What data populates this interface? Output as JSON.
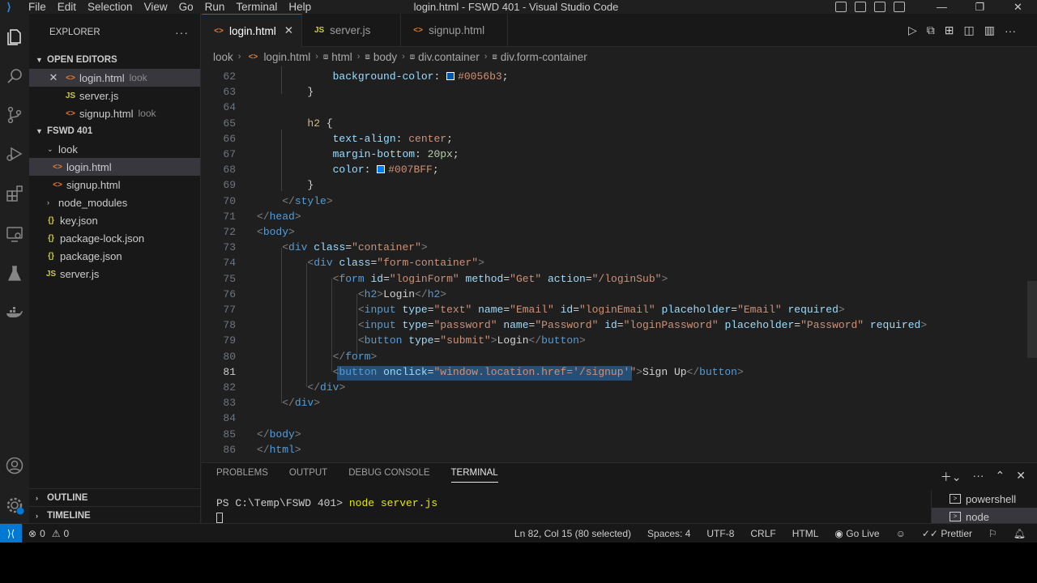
{
  "window": {
    "title": "login.html - FSWD 401 - Visual Studio Code",
    "menu": [
      "File",
      "Edit",
      "Selection",
      "View",
      "Go",
      "Run",
      "Terminal",
      "Help"
    ]
  },
  "explorer": {
    "title": "EXPLORER",
    "more": "···",
    "open_editors_label": "OPEN EDITORS",
    "open_editors": [
      {
        "name": "login.html",
        "desc": "look",
        "type": "html"
      },
      {
        "name": "server.js",
        "desc": "",
        "type": "js"
      },
      {
        "name": "signup.html",
        "desc": "look",
        "type": "html"
      }
    ],
    "workspace_label": "FSWD 401",
    "tree": [
      {
        "name": "look",
        "kind": "folder"
      },
      {
        "name": "login.html",
        "kind": "html"
      },
      {
        "name": "signup.html",
        "kind": "html"
      },
      {
        "name": "node_modules",
        "kind": "folder"
      },
      {
        "name": "key.json",
        "kind": "json"
      },
      {
        "name": "package-lock.json",
        "kind": "json"
      },
      {
        "name": "package.json",
        "kind": "json"
      },
      {
        "name": "server.js",
        "kind": "js"
      }
    ],
    "outline_label": "OUTLINE",
    "timeline_label": "TIMELINE"
  },
  "tabs": [
    {
      "label": "login.html",
      "type": "html",
      "active": true
    },
    {
      "label": "server.js",
      "type": "js",
      "active": false
    },
    {
      "label": "signup.html",
      "type": "html",
      "active": false
    }
  ],
  "breadcrumb": [
    "look",
    "login.html",
    "html",
    "body",
    "div.container",
    "div.form-container"
  ],
  "code": {
    "line_numbers": [
      "62",
      "63",
      "64",
      "65",
      "66",
      "67",
      "68",
      "69",
      "70",
      "71",
      "72",
      "73",
      "74",
      "75",
      "76",
      "77",
      "78",
      "79",
      "80",
      "81",
      "82",
      "83",
      "84",
      "85",
      "86"
    ],
    "current_line": "81",
    "lines": [
      "            background-color: #0056b3;",
      "        }",
      "",
      "        h2 {",
      "            text-align: center;",
      "            margin-bottom: 20px;",
      "            color: #007BFF;",
      "        }",
      "    </style>",
      "</head>",
      "<body>",
      "    <div class=\"container\">",
      "        <div class=\"form-container\">",
      "            <form id=\"loginForm\" method=\"Get\" action=\"/loginSub\">",
      "                <h2>Login</h2>",
      "                <input type=\"text\" name=\"Email\" id=\"loginEmail\" placeholder=\"Email\" required>",
      "                <input type=\"password\" name=\"Password\" id=\"loginPassword\" placeholder=\"Password\" required>",
      "                <button type=\"submit\">Login</button>",
      "            </form>",
      "            <button onclick=\"window.location.href='/signup'\">Sign Up</button>",
      "        </div>",
      "    </div>",
      "",
      "</body>",
      "</html>"
    ],
    "swatch_colors": {
      "line62": "#0056b3",
      "line68": "#007BFF"
    }
  },
  "panel": {
    "tabs": [
      "PROBLEMS",
      "OUTPUT",
      "DEBUG CONSOLE",
      "TERMINAL"
    ],
    "active_tab": "TERMINAL",
    "prompt": "PS C:\\Temp\\FSWD 401>",
    "command": "node server.js",
    "terminals": [
      "powershell",
      "node"
    ]
  },
  "status": {
    "errors": "0",
    "warnings": "0",
    "position": "Ln 82, Col 15 (80 selected)",
    "spaces": "Spaces: 4",
    "encoding": "UTF-8",
    "eol": "CRLF",
    "language": "HTML",
    "go_live": "Go Live",
    "prettier": "Prettier"
  },
  "colors": {
    "accent": "#0078d4",
    "selection": "#264f78",
    "html_icon": "#e37933",
    "js_icon": "#cbcb41"
  }
}
